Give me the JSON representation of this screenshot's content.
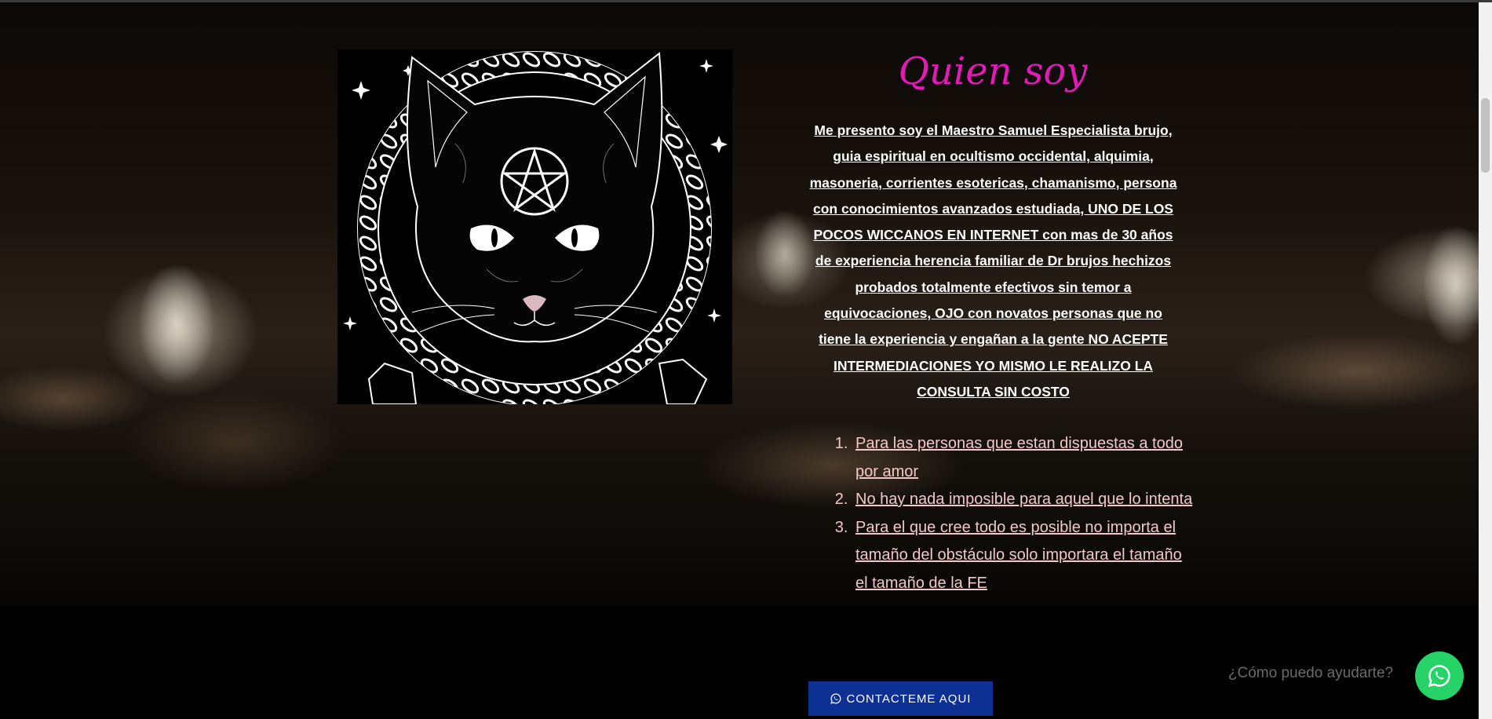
{
  "about": {
    "title": "Quien soy",
    "bio": "Me presento soy el Maestro Samuel  Especialista brujo, guia espiritual en ocultismo occidental, alquimia, masoneria, corrientes esotericas, chamanismo, persona con conocimientos avanzados estudiada, UNO DE LOS POCOS WICCANOS EN INTERNET con mas de 30 años de experiencia herencia familiar de Dr brujos hechizos probados totalmente efectivos sin temor a equivocaciones, OJO con novatos personas que no tiene la experiencia y engañan a la gente NO ACEPTE INTERMEDIACIONES YO MISMO LE REALIZO LA CONSULTA SIN COSTO",
    "reasons": [
      "Para las personas que estan dispuestas a todo por amor ",
      "No hay nada imposible para aquel que lo intenta ",
      "Para el que cree todo es posible no importa el tamaño del obstáculo solo importara el tamaño el tamaño de la FE"
    ]
  },
  "cta": {
    "contact_label": "CONTACTEME AQUI",
    "icon": "whatsapp-icon"
  },
  "chat": {
    "prompt": "¿Cómo puedo ayudarte?",
    "icon": "whatsapp-icon"
  },
  "colors": {
    "title": "#e31bb6",
    "button": "#0d3095",
    "whatsapp": "#25d366",
    "list_text": "#f2c8c8"
  },
  "image": {
    "subject": "black cat with pentagram inside celtic knot ring",
    "icon": "pentagram-cat-icon"
  }
}
